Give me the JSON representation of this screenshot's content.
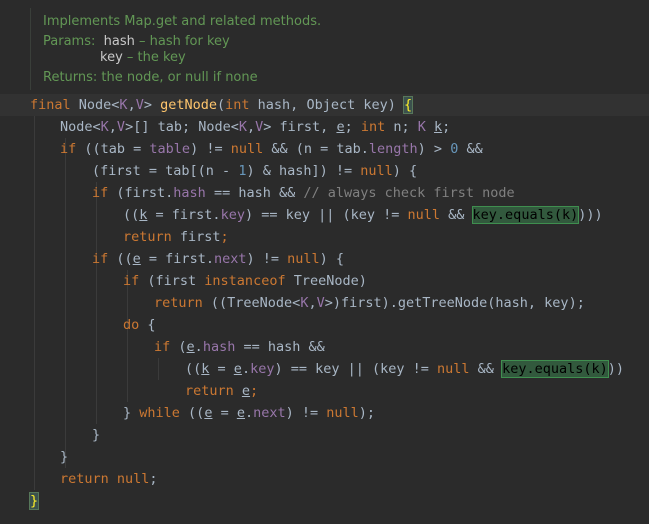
{
  "doc": {
    "summary": "Implements Map.get and related methods.",
    "params_label": "Params:",
    "param1_name": "hash",
    "param1_desc": " – hash for key",
    "param2_name": "key",
    "param2_desc": " – the key",
    "returns_label": "Returns:",
    "returns_desc": " the node, or null if none"
  },
  "code_lines": [
    {
      "indent": 30,
      "current": true,
      "tokens": [
        [
          "kw",
          "final "
        ],
        [
          "tx",
          "Node<"
        ],
        [
          "tp",
          "K"
        ],
        [
          "tx",
          ","
        ],
        [
          "tp",
          "V"
        ],
        [
          "tx",
          "> "
        ],
        [
          "fn",
          "getNode"
        ],
        [
          "tx",
          "("
        ],
        [
          "kw",
          "int "
        ],
        [
          "tx",
          "hash, Object key) "
        ],
        [
          "brk",
          "{"
        ]
      ]
    },
    {
      "indent": 60,
      "tokens": [
        [
          "tx",
          "Node<"
        ],
        [
          "tp",
          "K"
        ],
        [
          "tx",
          ","
        ],
        [
          "tp",
          "V"
        ],
        [
          "tx",
          ">[] tab; Node<"
        ],
        [
          "tp",
          "K"
        ],
        [
          "tx",
          ","
        ],
        [
          "tp",
          "V"
        ],
        [
          "tx",
          "> first, "
        ],
        [
          "u",
          "e"
        ],
        [
          "tx",
          "; "
        ],
        [
          "kw",
          "int "
        ],
        [
          "tx",
          "n; "
        ],
        [
          "tp",
          "K "
        ],
        [
          "u",
          "k"
        ],
        [
          "tx",
          ";"
        ]
      ]
    },
    {
      "indent": 60,
      "tokens": [
        [
          "kw",
          "if "
        ],
        [
          "tx",
          "((tab = "
        ],
        [
          "fld",
          "table"
        ],
        [
          "tx",
          ") != "
        ],
        [
          "kw",
          "null "
        ],
        [
          "tx",
          "&& (n = tab."
        ],
        [
          "fld",
          "length"
        ],
        [
          "tx",
          ") > "
        ],
        [
          "num",
          "0 "
        ],
        [
          "tx",
          "&&"
        ]
      ]
    },
    {
      "indent": 92,
      "tokens": [
        [
          "tx",
          "(first = tab[(n - "
        ],
        [
          "num",
          "1"
        ],
        [
          "tx",
          ") & hash]) != "
        ],
        [
          "kw",
          "null"
        ],
        [
          "tx",
          ") {"
        ]
      ]
    },
    {
      "indent": 92,
      "tokens": [
        [
          "kw",
          "if "
        ],
        [
          "tx",
          "(first."
        ],
        [
          "fld",
          "hash "
        ],
        [
          "tx",
          "== hash && "
        ],
        [
          "cmt",
          "// always check first node"
        ]
      ]
    },
    {
      "indent": 123,
      "tokens": [
        [
          "tx",
          "(("
        ],
        [
          "u",
          "k"
        ],
        [
          "tx",
          " = first."
        ],
        [
          "fld",
          "key"
        ],
        [
          "tx",
          ") == key || (key != "
        ],
        [
          "kw",
          "null "
        ],
        [
          "tx",
          "&& "
        ],
        [
          "hl",
          "key.equals(k)"
        ],
        [
          "tx",
          ")))"
        ]
      ]
    },
    {
      "indent": 123,
      "tokens": [
        [
          "kw",
          "return "
        ],
        [
          "tx",
          "first"
        ],
        [
          "kw",
          ";"
        ]
      ]
    },
    {
      "indent": 92,
      "tokens": [
        [
          "kw",
          "if "
        ],
        [
          "tx",
          "(("
        ],
        [
          "u",
          "e"
        ],
        [
          "tx",
          " = first."
        ],
        [
          "fld",
          "next"
        ],
        [
          "tx",
          ") != "
        ],
        [
          "kw",
          "null"
        ],
        [
          "tx",
          ") {"
        ]
      ]
    },
    {
      "indent": 123,
      "tokens": [
        [
          "kw",
          "if "
        ],
        [
          "tx",
          "(first "
        ],
        [
          "kw",
          "instanceof "
        ],
        [
          "tx",
          "TreeNode)"
        ]
      ]
    },
    {
      "indent": 154,
      "tokens": [
        [
          "kw",
          "return "
        ],
        [
          "tx",
          "((TreeNode<"
        ],
        [
          "tp",
          "K"
        ],
        [
          "tx",
          ","
        ],
        [
          "tp",
          "V"
        ],
        [
          "tx",
          ">)first).getTreeNode(hash, key);"
        ]
      ]
    },
    {
      "indent": 123,
      "tokens": [
        [
          "kw",
          "do "
        ],
        [
          "tx",
          "{"
        ]
      ]
    },
    {
      "indent": 154,
      "tokens": [
        [
          "kw",
          "if "
        ],
        [
          "tx",
          "("
        ],
        [
          "u",
          "e"
        ],
        [
          "tx",
          "."
        ],
        [
          "fld",
          "hash "
        ],
        [
          "tx",
          "== hash &&"
        ]
      ]
    },
    {
      "indent": 185,
      "tokens": [
        [
          "tx",
          "(("
        ],
        [
          "u",
          "k"
        ],
        [
          "tx",
          " = "
        ],
        [
          "u",
          "e"
        ],
        [
          "tx",
          "."
        ],
        [
          "fld",
          "key"
        ],
        [
          "tx",
          ") == key || (key != "
        ],
        [
          "kw",
          "null "
        ],
        [
          "tx",
          "&& "
        ],
        [
          "hl",
          "key.equals(k)"
        ],
        [
          "tx",
          "))"
        ]
      ]
    },
    {
      "indent": 185,
      "tokens": [
        [
          "kw",
          "return "
        ],
        [
          "u",
          "e"
        ],
        [
          "kw",
          ";"
        ]
      ]
    },
    {
      "indent": 123,
      "tokens": [
        [
          "tx",
          "} "
        ],
        [
          "kw",
          "while "
        ],
        [
          "tx",
          "(("
        ],
        [
          "u",
          "e"
        ],
        [
          "tx",
          " = "
        ],
        [
          "u",
          "e"
        ],
        [
          "tx",
          "."
        ],
        [
          "fld",
          "next"
        ],
        [
          "tx",
          ") != "
        ],
        [
          "kw",
          "null"
        ],
        [
          "tx",
          ");"
        ]
      ]
    },
    {
      "indent": 92,
      "tokens": [
        [
          "tx",
          "}"
        ]
      ]
    },
    {
      "indent": 60,
      "tokens": [
        [
          "tx",
          "}"
        ]
      ]
    },
    {
      "indent": 60,
      "tokens": [
        [
          "kw",
          "return null"
        ],
        [
          "tx",
          ";"
        ]
      ]
    },
    {
      "indent": 30,
      "tokens": [
        [
          "brk",
          "}"
        ]
      ]
    }
  ]
}
